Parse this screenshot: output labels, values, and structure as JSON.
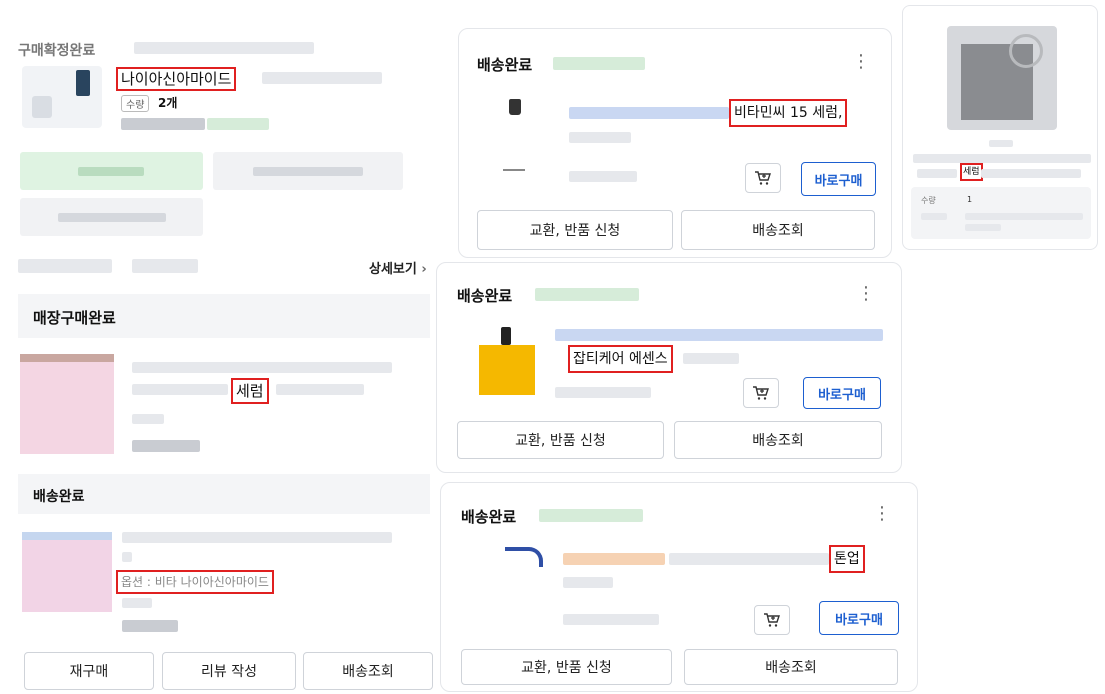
{
  "left": {
    "order_status": "구매확정완료",
    "product_name_hl": "나이아신아마이드",
    "qty_badge": "수량",
    "qty_value": "2개",
    "more_link": "상세보기",
    "store_title": "매장구매완료",
    "store_hl": "세럼",
    "delivery_title": "배송완료",
    "option_hl": "옵션 : 비타 나이아신아마이드",
    "buttons": [
      "재구매",
      "리뷰 작성",
      "배송조회"
    ]
  },
  "cards": [
    {
      "status": "배송완료",
      "highlight": "비타민씨 15 세럼,",
      "cart_icon": "cart-plus-icon",
      "buy": "바로구매",
      "exchange": "교환, 반품 신청",
      "track": "배송조회"
    },
    {
      "status": "배송완료",
      "highlight": "잡티케어 에센스",
      "cart_icon": "cart-plus-icon",
      "buy": "바로구매",
      "exchange": "교환, 반품 신청",
      "track": "배송조회"
    },
    {
      "status": "배송완료",
      "highlight": "톤업",
      "cart_icon": "cart-plus-icon",
      "buy": "바로구매",
      "exchange": "교환, 반품 신청",
      "track": "배송조회"
    }
  ],
  "right_panel": {
    "highlight": "세럼",
    "qty_label": "수량",
    "qty_value": "1"
  },
  "colors": {
    "highlight_border": "#e02020",
    "buy_blue": "#1d5fd0",
    "product_yellow": "#f5b800"
  }
}
